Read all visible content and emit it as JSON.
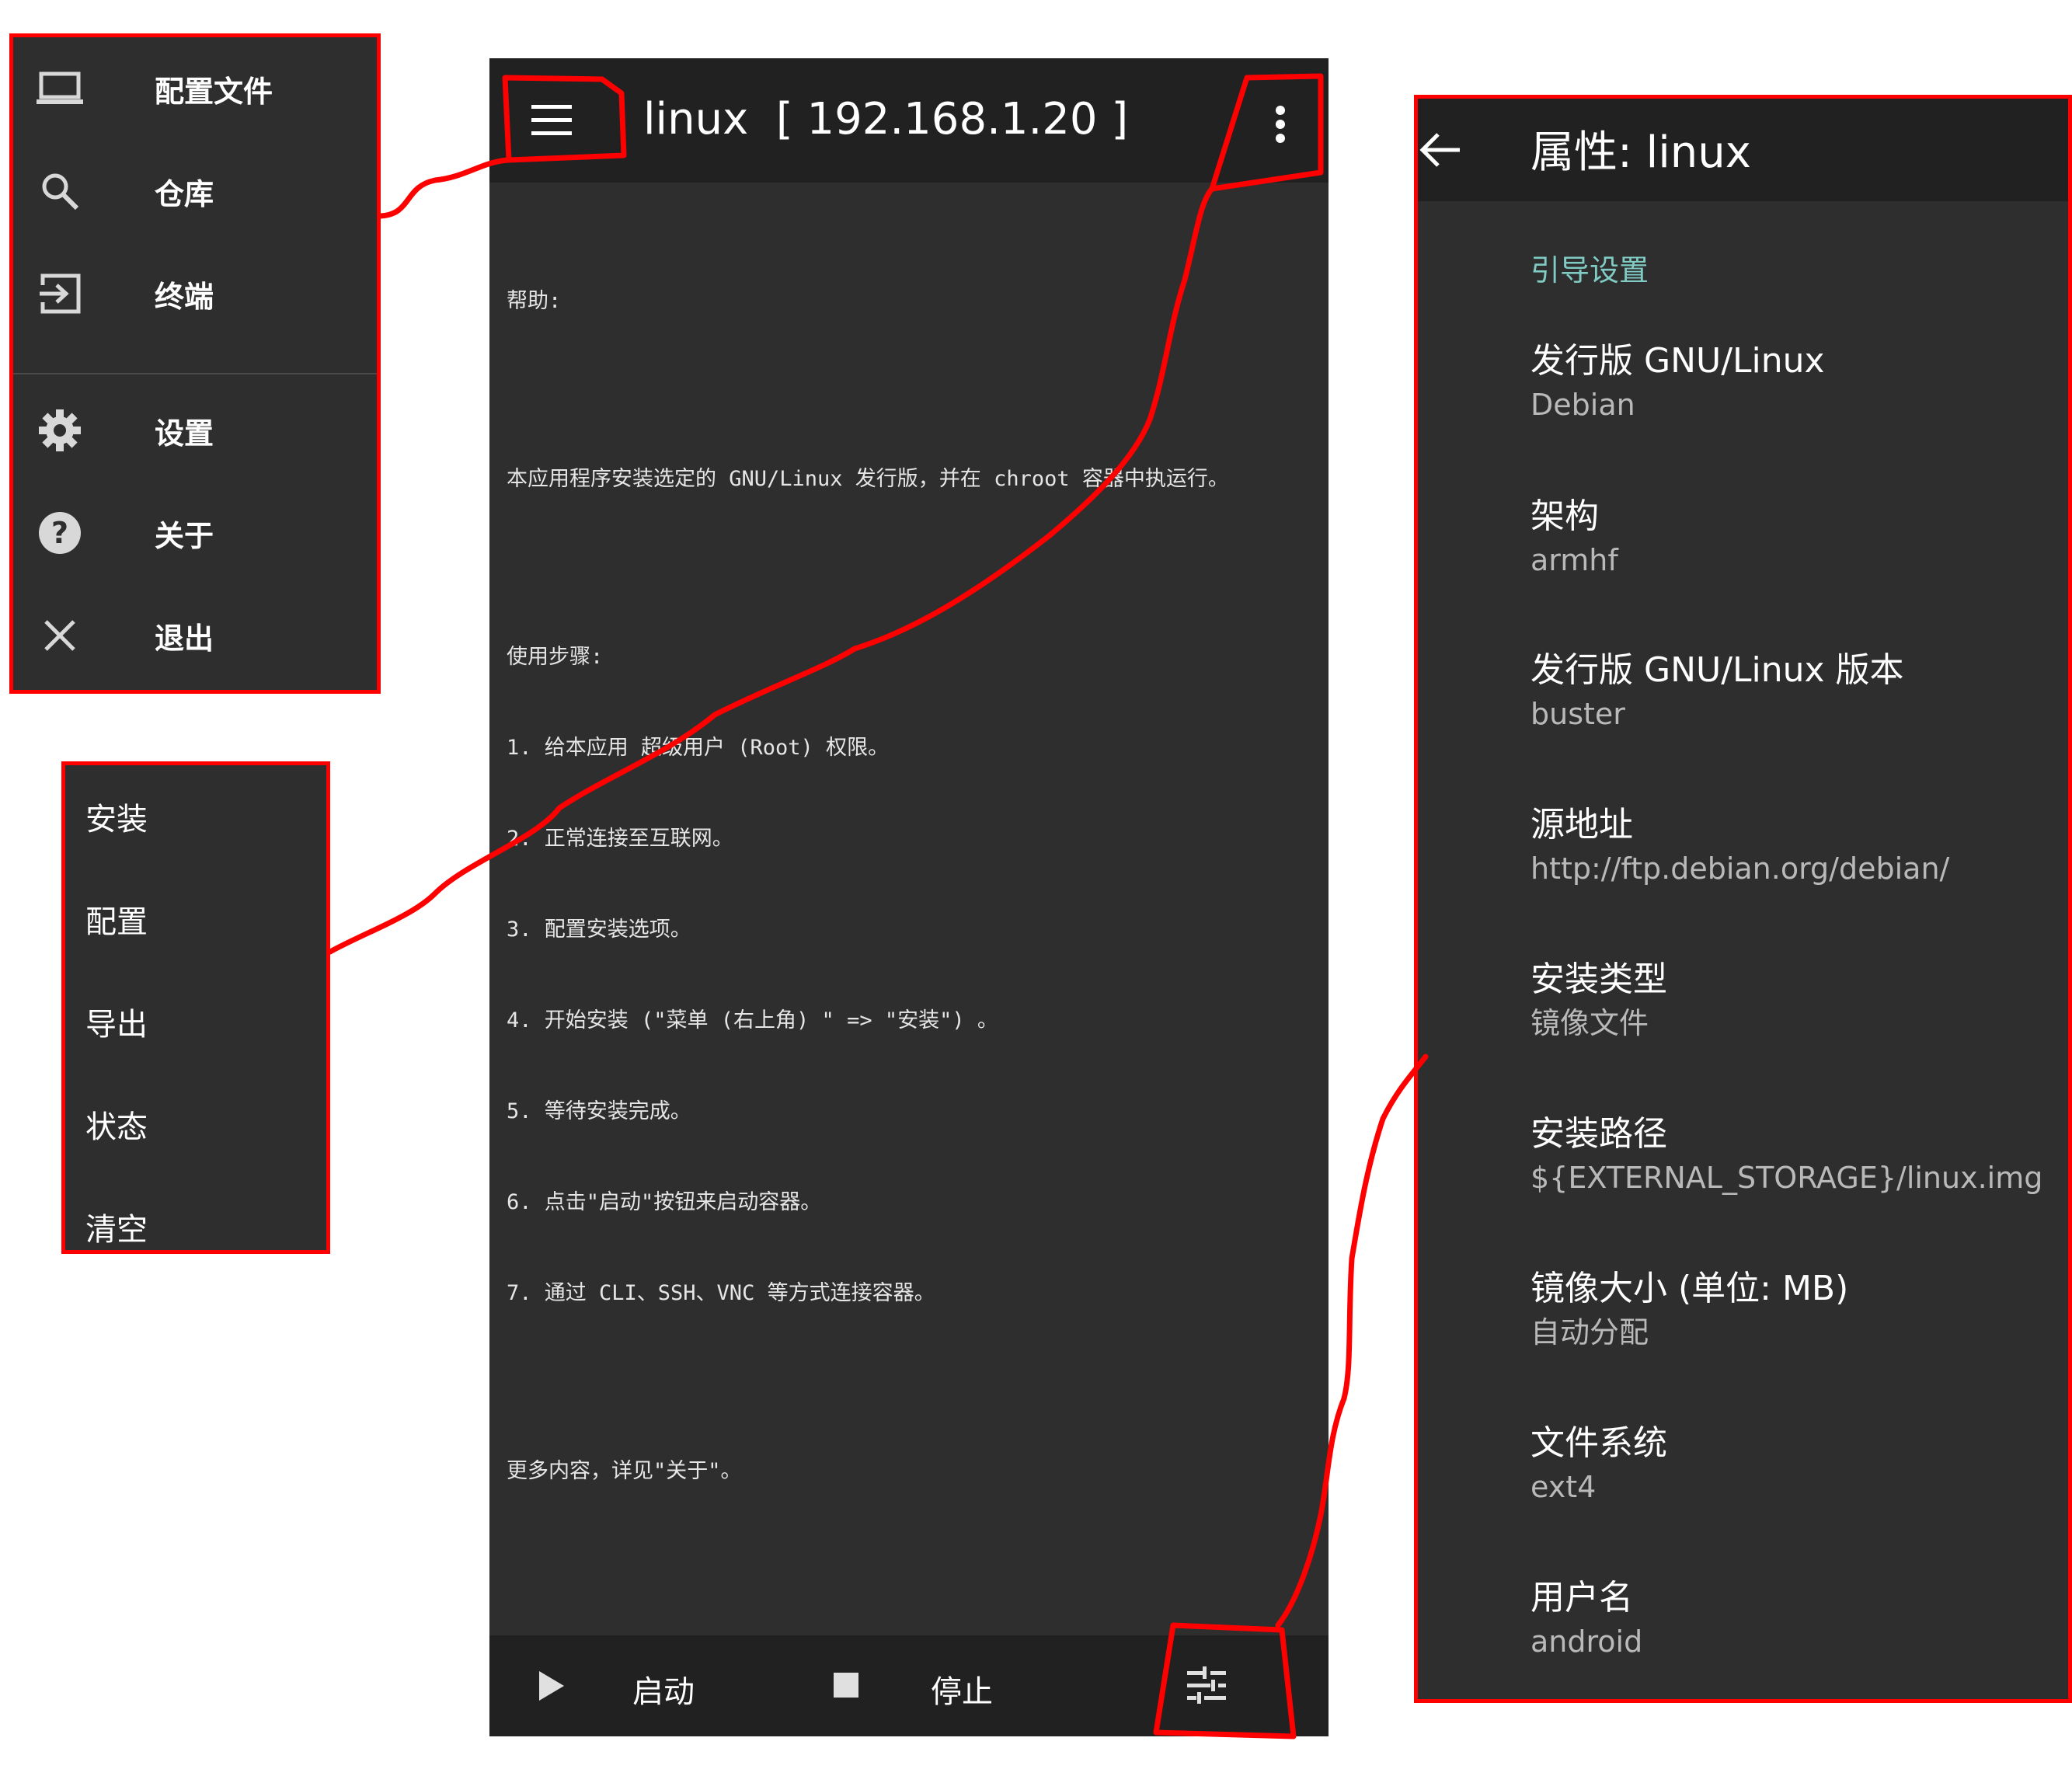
{
  "drawer": {
    "items": [
      {
        "label": "配置文件",
        "icon": "laptop-icon"
      },
      {
        "label": "仓库",
        "icon": "search-icon"
      },
      {
        "label": "终端",
        "icon": "terminal-enter-icon"
      },
      {
        "label": "设置",
        "icon": "gear-icon"
      },
      {
        "label": "关于",
        "icon": "help-icon"
      },
      {
        "label": "退出",
        "icon": "close-icon"
      }
    ]
  },
  "menu": {
    "items": [
      "安装",
      "配置",
      "导出",
      "状态",
      "清空"
    ]
  },
  "main": {
    "title": "linux  [ 192.168.1.20 ]",
    "help": {
      "heading": "帮助:",
      "intro": "本应用程序安装选定的 GNU/Linux 发行版，并在 chroot 容器中执运行。",
      "steps_heading": "使用步骤:",
      "steps": [
        "1. 给本应用 超级用户 (Root) 权限。",
        "2. 正常连接至互联网。",
        "3. 配置安装选项。",
        "4. 开始安装 (\"菜单 (右上角) \" => \"安装\") 。",
        "5. 等待安装完成。",
        "6. 点击\"启动\"按钮来启动容器。",
        "7. 通过 CLI、SSH、VNC 等方式连接容器。"
      ],
      "more": "更多内容，详见\"关于\"。"
    },
    "bottom": {
      "start_label": "启动",
      "stop_label": "停止"
    }
  },
  "properties": {
    "title": "属性: linux",
    "section": "引导设置",
    "items": [
      {
        "title": "发行版 GNU/Linux",
        "value": "Debian"
      },
      {
        "title": "架构",
        "value": "armhf"
      },
      {
        "title": "发行版 GNU/Linux 版本",
        "value": "buster"
      },
      {
        "title": "源地址",
        "value": "http://ftp.debian.org/debian/"
      },
      {
        "title": "安装类型",
        "value": "镜像文件"
      },
      {
        "title": "安装路径",
        "value": "${EXTERNAL_STORAGE}/linux.img"
      },
      {
        "title": "镜像大小 (单位: MB)",
        "value": "自动分配"
      },
      {
        "title": "文件系统",
        "value": "ext4"
      },
      {
        "title": "用户名",
        "value": "android"
      }
    ]
  },
  "colors": {
    "accent": "#80cbc4",
    "annotation": "#ff0000",
    "panel": "#2e2e2e",
    "toolbar": "#212121"
  }
}
